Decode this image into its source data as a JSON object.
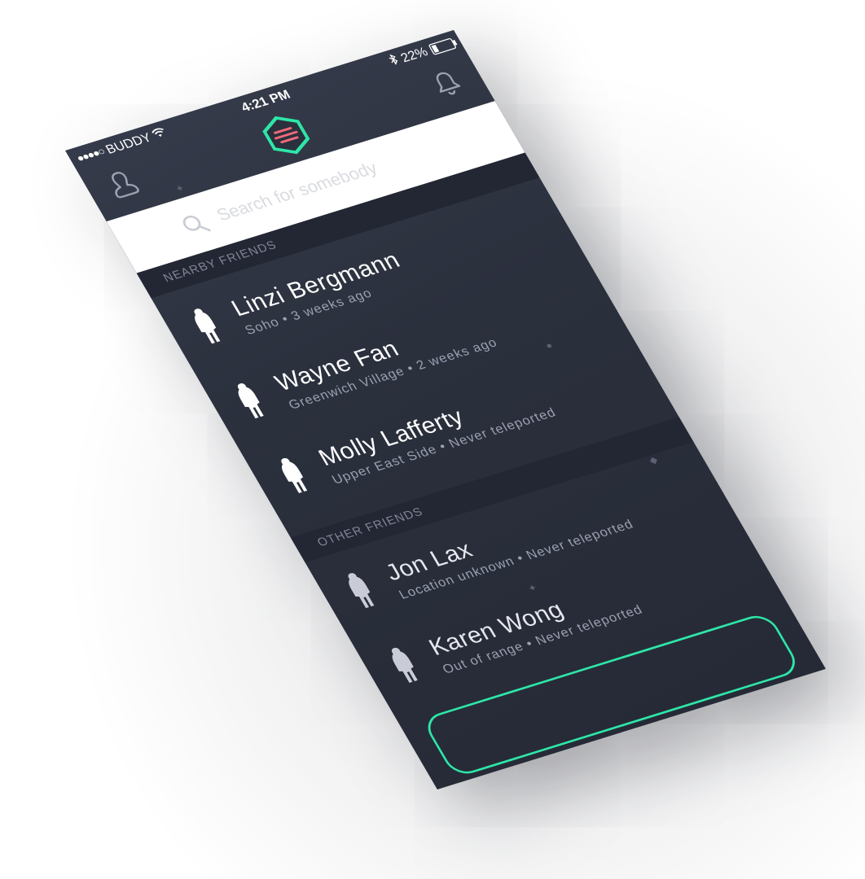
{
  "status": {
    "signal_dots": "●●●●○",
    "carrier": "BUDDY",
    "time": "4:21 PM",
    "battery_pct": "22%"
  },
  "search": {
    "placeholder": "Search for somebody",
    "value": ""
  },
  "sections": {
    "nearby_title": "NEARBY FRIENDS",
    "other_title": "OTHER FRIENDS"
  },
  "nearby": [
    {
      "name": "Linzi Bergmann",
      "meta": "Soho • 3 weeks ago"
    },
    {
      "name": "Wayne Fan",
      "meta": "Greenwich Village • 2 weeks ago"
    },
    {
      "name": "Molly Lafferty",
      "meta": "Upper East Side • Never teleported"
    }
  ],
  "other": [
    {
      "name": "Jon Lax",
      "meta": "Location unknown • Never teleported"
    },
    {
      "name": "Karen Wong",
      "meta": "Out of range • Never teleported"
    }
  ],
  "icons": {
    "profile": "person-outline-icon",
    "bell": "bell-icon",
    "logo": "hexagon-logo-icon",
    "search": "search-icon",
    "avatar": "person-silhouette-icon",
    "wifi": "wifi-icon",
    "bluetooth": "bluetooth-icon",
    "battery": "battery-icon"
  },
  "colors": {
    "accent": "#2ee6a8",
    "logo_lines": "#f06a7a",
    "background": "#2b303d",
    "section_header": "#232733"
  }
}
